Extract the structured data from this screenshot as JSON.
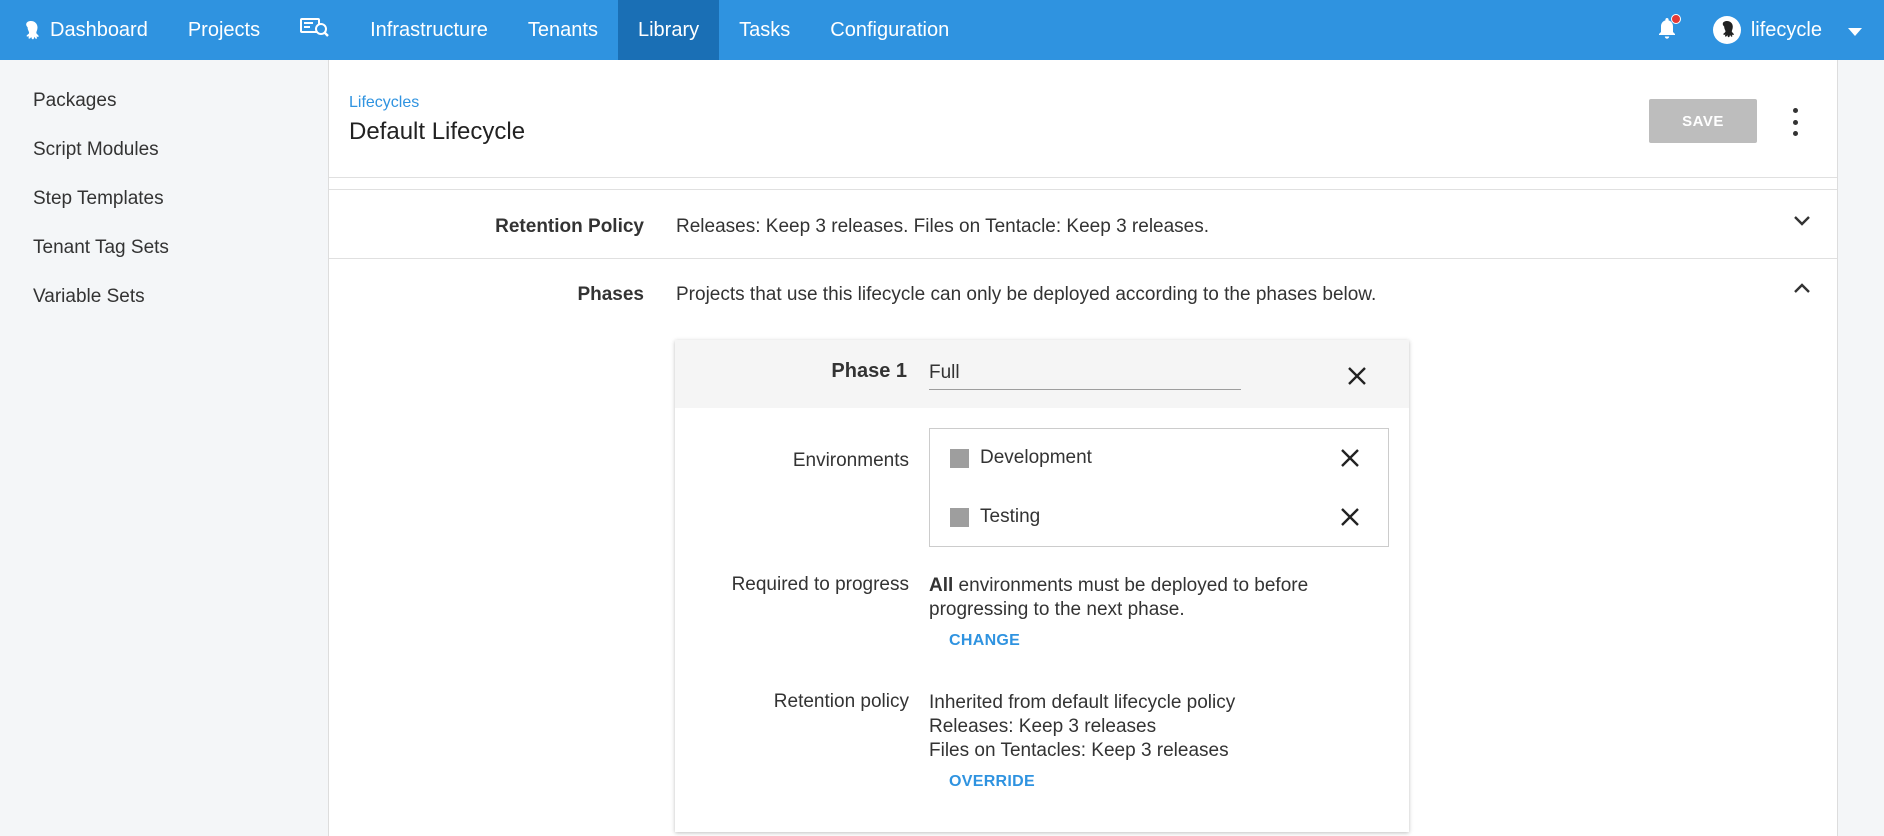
{
  "nav": {
    "items": [
      {
        "label": "Dashboard",
        "icon": "octopus-logo-icon"
      },
      {
        "label": "Projects"
      },
      {
        "label": "",
        "icon": "search-machines-icon"
      },
      {
        "label": "Infrastructure"
      },
      {
        "label": "Tenants"
      },
      {
        "label": "Library",
        "active": true
      },
      {
        "label": "Tasks"
      },
      {
        "label": "Configuration"
      }
    ],
    "user": {
      "name": "lifecycle"
    }
  },
  "sidebar": {
    "items": [
      {
        "label": "Packages"
      },
      {
        "label": "Script Modules"
      },
      {
        "label": "Step Templates"
      },
      {
        "label": "Tenant Tag Sets"
      },
      {
        "label": "Variable Sets"
      }
    ]
  },
  "header": {
    "breadcrumb": "Lifecycles",
    "title": "Default Lifecycle",
    "save_label": "SAVE"
  },
  "retention": {
    "label": "Retention Policy",
    "value": "Releases: Keep 3 releases. Files on Tentacle: Keep 3 releases."
  },
  "phases": {
    "label": "Phases",
    "description": "Projects that use this lifecycle can only be deployed according to the phases below.",
    "phase": {
      "label": "Phase 1",
      "name": "Full",
      "environments_label": "Environments",
      "environments": [
        {
          "name": "Development"
        },
        {
          "name": "Testing"
        }
      ],
      "progress_label": "Required to progress",
      "progress_bold": "All",
      "progress_text_1": " environments must be deployed to before",
      "progress_text_2": "progressing to the next phase.",
      "change_label": "CHANGE",
      "retention_label": "Retention policy",
      "retention_line1": "Inherited from default lifecycle policy",
      "retention_line2": "Releases: Keep 3 releases",
      "retention_line3": "Files on Tentacles: Keep 3 releases",
      "override_label": "OVERRIDE"
    }
  },
  "colors": {
    "nav_bg": "#2f93e0",
    "nav_active": "#1a6fb5",
    "link": "#2f93e0",
    "save_disabled": "#bdbdbd",
    "notification_dot": "#e53935"
  }
}
